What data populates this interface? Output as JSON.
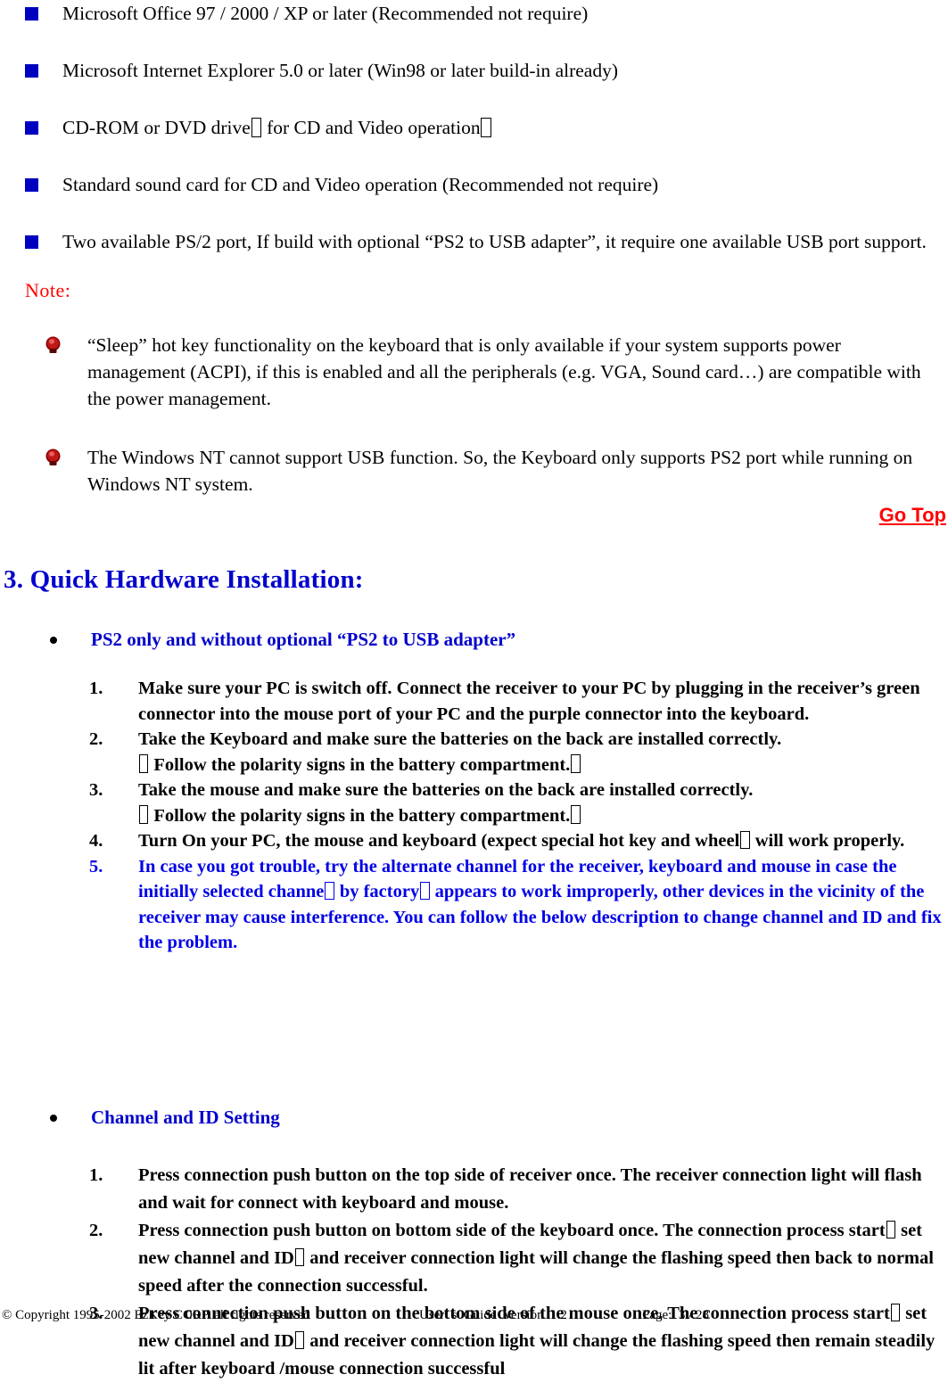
{
  "colors": {
    "bullet_blue": "#0000C0",
    "heading_blue": "#0000CC",
    "note_red": "#FF0000",
    "gem_red": "#A01010",
    "body_black": "#000000"
  },
  "requirements": [
    {
      "text": "Microsoft Office 97 / 2000 / XP or later (Recommended not require)"
    },
    {
      "text": "Microsoft Internet Explorer 5.0 or later (Win98 or later build-in already)"
    },
    {
      "text": "CD-ROM or DVD drive� for CD and Video operation�"
    },
    {
      "text": "Standard sound card for CD and Video operation (Recommended not require)"
    },
    {
      "text": "Two available PS/2 port, If build with optional “PS2 to USB adapter”, it require one available USB port support."
    }
  ],
  "note": {
    "heading": "Note:",
    "items": [
      {
        "text": "“Sleep” hot key functionality on the keyboard that is only available if your system supports power management (ACPI), if this is enabled and all the peripherals (e.g. VGA, Sound card…) are compatible with the power management."
      },
      {
        "text": "The Windows NT cannot support USB function. So, the Keyboard only supports PS2 port while running on Windows NT system."
      }
    ]
  },
  "go_top": {
    "label": "Go Top"
  },
  "section": {
    "heading": "3. Quick Hardware Installation:"
  },
  "ps2_section": {
    "bullet_label": "PS2 only and without optional “PS2 to USB adapter”",
    "steps": [
      {
        "num": "1.",
        "text": "Make sure your PC is switch off. Connect the receiver to your PC by plugging in the receiver’s green connector into the mouse port of your PC and the purple connector into the keyboard.",
        "color": "black"
      },
      {
        "num": "2.",
        "text": "Take the Keyboard and make sure the batteries on the back are installed correctly.\n� Follow the polarity signs in the battery compartment.�",
        "color": "black"
      },
      {
        "num": "3.",
        "text": "Take the mouse and make sure the batteries on the back are installed correctly.\n� Follow the polarity signs in the battery compartment.�",
        "color": "black"
      },
      {
        "num": "4.",
        "text": "Turn On your PC, the mouse and keyboard (expect special hot key and wheel� will work properly.",
        "color": "black"
      },
      {
        "num": "5.",
        "text": "In case you got trouble, try the alternate channel for the receiver, keyboard and mouse in case the initially selected channe� by factory� appears to work improperly, other devices in the vicinity of the receiver may cause interference. You can follow the below description to change channel and ID and fix the problem.",
        "color": "blue"
      }
    ]
  },
  "channel_section": {
    "bullet_label": "Channel and ID Setting",
    "steps": [
      {
        "num": "1.",
        "text": "Press connection push button on the top side of receiver once. The receiver connection light will flash and wait for connect with keyboard and mouse.",
        "color": "black"
      },
      {
        "num": "2.",
        "text": "Press connection push button on bottom side of the keyboard once. The connection process start� set new channel and ID� and receiver connection light will change the flashing speed then back to normal speed after the connection successful.",
        "color": "black"
      },
      {
        "num": "3.",
        "text": "Press connection push button on the bottom side of the mouse once. The connection process start� set new channel and ID� and receiver connection light will change the flashing speed then remain steadily lit after keyboard /mouse connection successful",
        "color": "black"
      }
    ]
  },
  "footer": {
    "copyright": "© Copyright 1995-2002 EzKey CORP. all rights reserved",
    "guide": "User’ s  Guide  Version  1.2",
    "page": "Page:  3 / 28"
  }
}
